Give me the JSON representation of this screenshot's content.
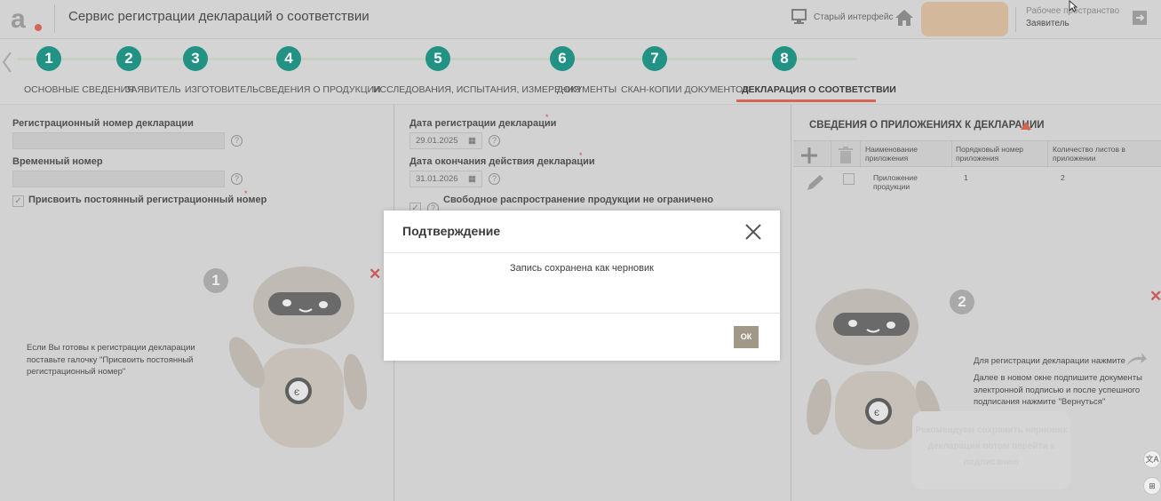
{
  "header": {
    "app_title": "Сервис регистрации деклараций о соответствии",
    "old_interface": "Старый интерфейс",
    "workspace_label": "Рабочее пространство",
    "workspace_value": "Заявитель"
  },
  "steps": [
    {
      "num": "1",
      "label": "ОСНОВНЫЕ СВЕДЕНИЯ"
    },
    {
      "num": "2",
      "label": "ЗАЯВИТЕЛЬ"
    },
    {
      "num": "3",
      "label": "ИЗГОТОВИТЕЛЬ"
    },
    {
      "num": "4",
      "label": "СВЕДЕНИЯ О ПРОДУКЦИИ"
    },
    {
      "num": "5",
      "label": "ИССЛЕДОВАНИЯ, ИСПЫТАНИЯ, ИЗМЕРЕНИЯ"
    },
    {
      "num": "6",
      "label": "ДОКУМЕНТЫ"
    },
    {
      "num": "7",
      "label": "СКАН-КОПИИ ДОКУМЕНТОВ"
    },
    {
      "num": "8",
      "label": "ДЕКЛАРАЦИЯ О СООТВЕТСТВИИ"
    }
  ],
  "left": {
    "reg_number_label": "Регистрационный номер декларации",
    "temp_number_label": "Временный номер",
    "assign_label": "Присвоить постоянный регистрационный номер",
    "robot_badge": "1",
    "robot_text": "Если Вы готовы к регистрации декларации поставьте галочку \"Присвоить постоянный регистрационный номер\""
  },
  "middle": {
    "reg_date_label": "Дата регистрации декларации",
    "reg_date_value": "29.01.2025",
    "end_date_label": "Дата окончания действия декларации",
    "end_date_value": "31.01.2026",
    "free_dist_label": "Свободное распространение продукции не ограничено"
  },
  "right": {
    "title": "СВЕДЕНИЯ О ПРИЛОЖЕНИЯХ К ДЕКЛАРАЦИИ",
    "columns": [
      "Наименование приложения",
      "Порядковый номер приложения",
      "Количество листов в приложении"
    ],
    "rows": [
      {
        "name": "Приложение продукции",
        "number": "1",
        "sheets": "2"
      }
    ],
    "robot_badge": "2",
    "hint_title": "Для регистрации декларации нажмите",
    "hint_body": "Далее в новом окне подпишите документы электронной подписью и после успешного подписания нажмите \"Вернуться\"",
    "speech": "Рекомендуем сохранить черновик декларации потом перейти к подписанию"
  },
  "modal": {
    "title": "Подтверждение",
    "message": "Запись сохранена как черновик",
    "ok_label": "ОК"
  },
  "colors": {
    "step_teal": "#219284",
    "accent_red": "#d76554",
    "ok_button": "#a19887"
  }
}
